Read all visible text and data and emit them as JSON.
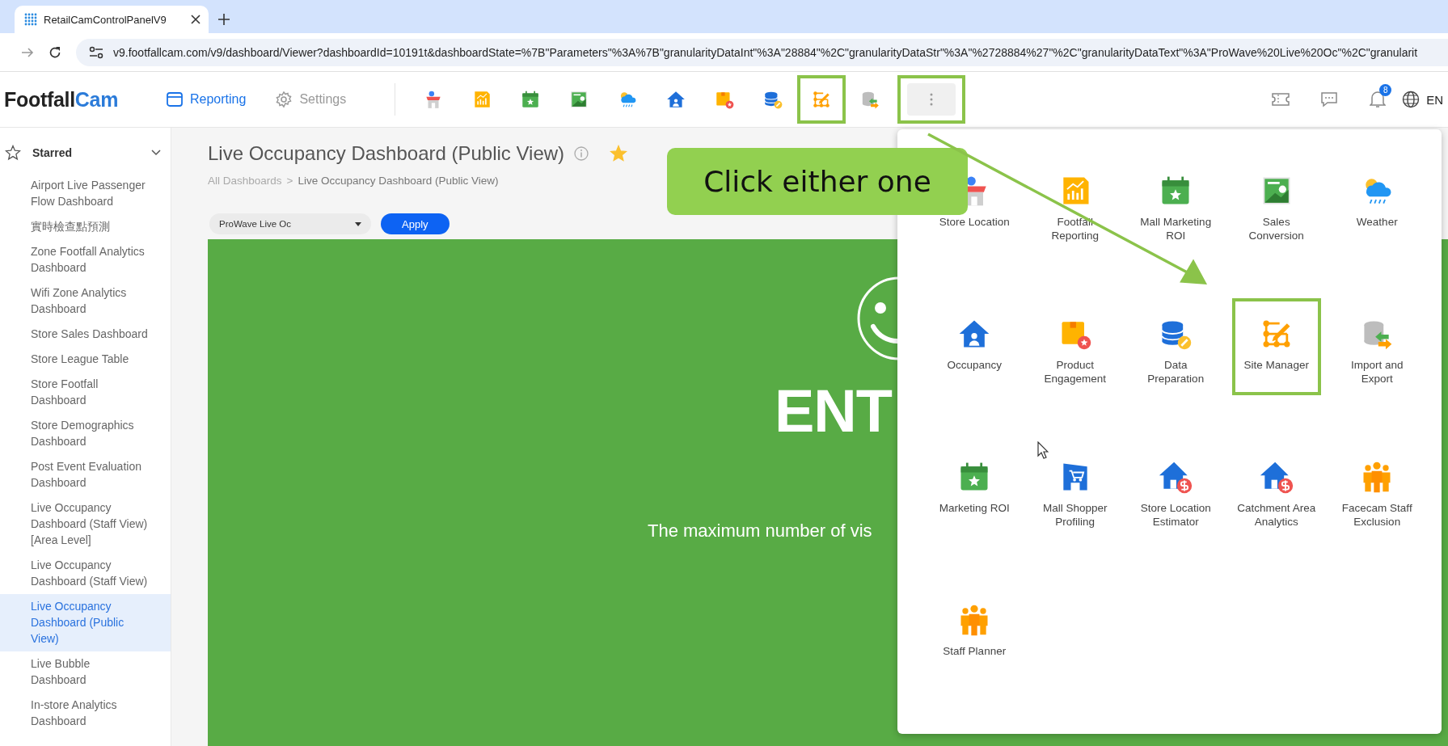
{
  "browser": {
    "tab": {
      "title": "RetailCamControlPanelV9"
    },
    "url": "v9.footfallcam.com/v9/dashboard/Viewer?dashboardId=10191t&dashboardState=%7B\"Parameters\"%3A%7B\"granularityDataInt\"%3A\"28884\"%2C\"granularityDataStr\"%3A\"%2728884%27\"%2C\"granularityDataText\"%3A\"ProWave%20Live%20Oc\"%2C\"granularit"
  },
  "header": {
    "logo": {
      "part_1": "Footfall",
      "part_2": "Cam"
    },
    "nav": [
      {
        "label": "Reporting",
        "selected": true
      },
      {
        "label": "Settings",
        "selected": false
      }
    ],
    "toolbar": [
      {
        "highlighted": false
      },
      {
        "highlighted": false
      },
      {
        "highlighted": false
      },
      {
        "highlighted": false
      },
      {
        "highlighted": false
      },
      {
        "highlighted": false
      },
      {
        "highlighted": false
      },
      {
        "highlighted": false
      },
      {
        "highlighted": true
      },
      {
        "highlighted": false
      }
    ],
    "more_button": {
      "highlighted": true
    },
    "notifications": {
      "badge": "8"
    },
    "language": "EN"
  },
  "sidebar": {
    "section": "Starred",
    "expanded": true,
    "items": [
      {
        "label": "Airport Live Passenger Flow Dashboard",
        "selected": false
      },
      {
        "label": "實時檢查點預測",
        "selected": false
      },
      {
        "label": "Zone Footfall Analytics Dashboard",
        "selected": false
      },
      {
        "label": "Wifi Zone Analytics Dashboard",
        "selected": false
      },
      {
        "label": "Store Sales Dashboard",
        "selected": false
      },
      {
        "label": "Store League Table",
        "selected": false
      },
      {
        "label": "Store Footfall Dashboard",
        "selected": false
      },
      {
        "label": "Store Demographics Dashboard",
        "selected": false
      },
      {
        "label": "Post Event Evaluation Dashboard",
        "selected": false
      },
      {
        "label": "Live Occupancy Dashboard (Staff View) [Area Level]",
        "selected": false
      },
      {
        "label": "Live Occupancy Dashboard (Staff View)",
        "selected": false
      },
      {
        "label": "Live Occupancy Dashboard (Public View)",
        "selected": true
      },
      {
        "label": "Live Bubble Dashboard",
        "selected": false
      },
      {
        "label": "In-store Analytics Dashboard",
        "selected": false
      }
    ]
  },
  "main": {
    "title": "Live Occupancy Dashboard (Public View)",
    "starred": true,
    "breadcrumb": [
      {
        "label": "All Dashboards",
        "kind": "link"
      },
      {
        "label": ">",
        "kind": "separator"
      },
      {
        "label": "Live Occupancy Dashboard (Public View)",
        "kind": "current"
      }
    ],
    "filter": {
      "value": "ProWave Live Oc"
    },
    "apply_button": "Apply",
    "panel": {
      "heading": "ENT",
      "text": "The maximum number of vis"
    }
  },
  "apps_menu": {
    "items": [
      {
        "label": "Store Location",
        "highlighted": false
      },
      {
        "label": "Footfall Reporting",
        "highlighted": false
      },
      {
        "label": "Mall Marketing ROI",
        "highlighted": false
      },
      {
        "label": "Sales Conversion",
        "highlighted": false
      },
      {
        "label": "Weather",
        "highlighted": false
      },
      {
        "label": "Occupancy",
        "highlighted": false
      },
      {
        "label": "Product Engagement",
        "highlighted": false
      },
      {
        "label": "Data Preparation",
        "highlighted": false
      },
      {
        "label": "Site Manager",
        "highlighted": true
      },
      {
        "label": "Import and Export",
        "highlighted": false
      },
      {
        "label": "Marketing ROI",
        "highlighted": false
      },
      {
        "label": "Mall Shopper Profiling",
        "highlighted": false
      },
      {
        "label": "Store Location Estimator",
        "highlighted": false
      },
      {
        "label": "Catchment Area Analytics",
        "highlighted": false
      },
      {
        "label": "Facecam Staff Exclusion",
        "highlighted": false
      },
      {
        "label": "Staff Planner",
        "highlighted": false
      }
    ]
  },
  "callout": "Click either one"
}
